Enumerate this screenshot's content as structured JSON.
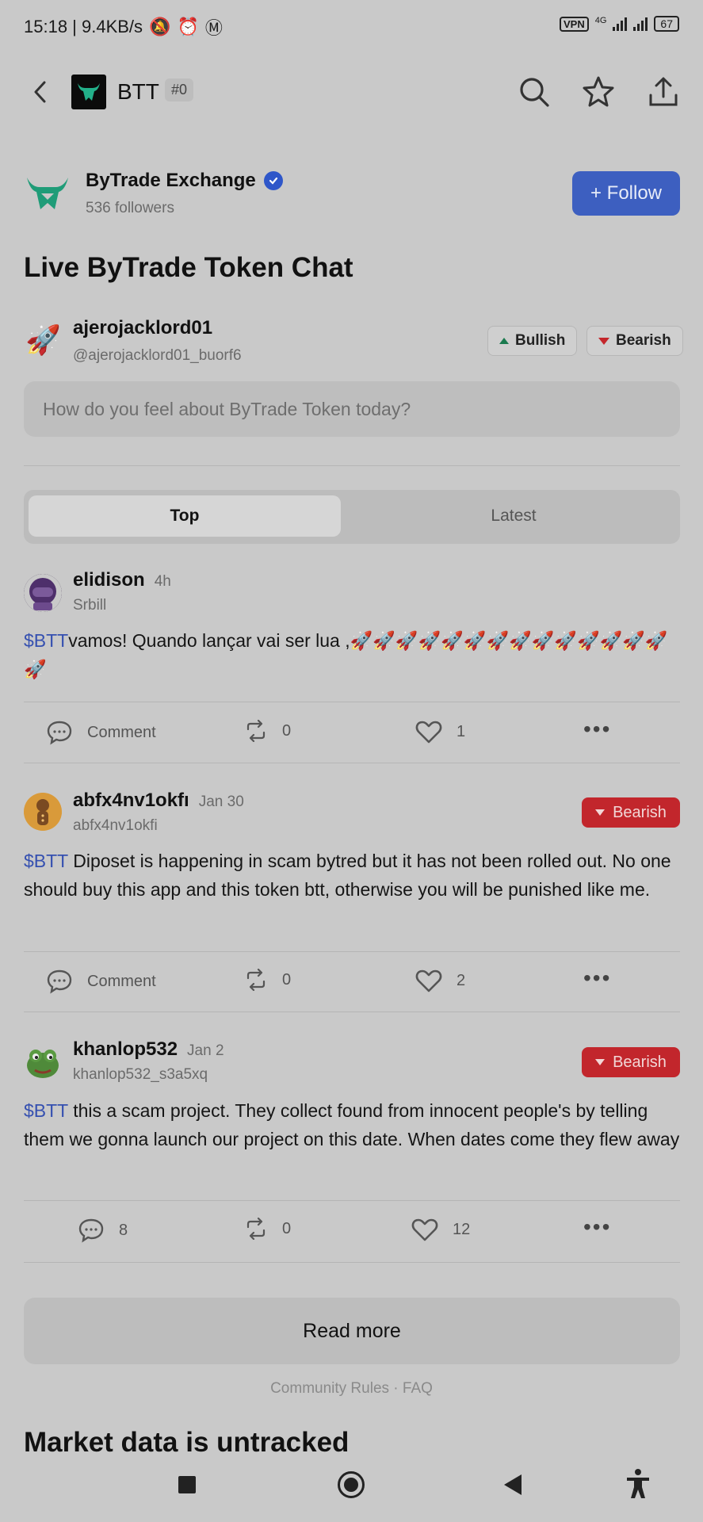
{
  "status_bar": {
    "time_speed": "15:18 | 9.4KB/s",
    "vpn": "VPN",
    "net": "4G",
    "battery": "67"
  },
  "header": {
    "ticker": "BTT",
    "rank": "#0"
  },
  "profile": {
    "name": "ByTrade Exchange",
    "followers": "536 followers",
    "follow_label": "+ Follow"
  },
  "chat_title": "Live ByTrade Token Chat",
  "composer": {
    "username": "ajerojacklord01",
    "handle": "@ajerojacklord01_buorf6",
    "bullish_label": "Bullish",
    "bearish_label": "Bearish",
    "placeholder": "How do you feel about ByTrade Token today?"
  },
  "tabs": {
    "top": "Top",
    "latest": "Latest"
  },
  "posts": [
    {
      "username": "elidison",
      "time": "4h",
      "handle": "Srbill",
      "ticker": "$BTT",
      "text": "vamos! Quando lançar vai ser lua ,🚀🚀🚀🚀🚀🚀🚀🚀🚀🚀🚀🚀🚀🚀🚀",
      "comments": "Comment",
      "reposts": "0",
      "likes": "1",
      "sentiment": ""
    },
    {
      "username": "abfx4nv1okfı",
      "time": "Jan 30",
      "handle": "abfx4nv1okfi",
      "ticker": "$BTT",
      "text": " Diposet is happening in scam bytred but it has not been rolled out. No one should buy this app and this token btt, otherwise you will be punished like me.",
      "comments": "Comment",
      "reposts": "0",
      "likes": "2",
      "sentiment": "Bearish"
    },
    {
      "username": "khanlop532",
      "time": "Jan 2",
      "handle": "khanlop532_s3a5xq",
      "ticker": "$BTT",
      "text": " this a scam project. They collect found from innocent people's by telling them we gonna launch our project on this date. When dates come they flew away",
      "comments": "8",
      "reposts": "0",
      "likes": "12",
      "sentiment": "Bearish"
    }
  ],
  "read_more": "Read more",
  "footer_links": "Community Rules · FAQ",
  "market_title": "Market data is untracked"
}
